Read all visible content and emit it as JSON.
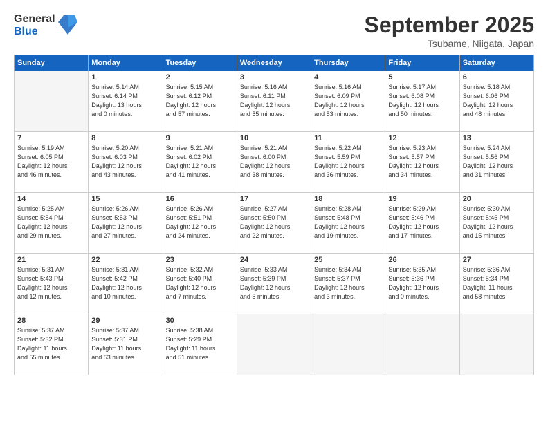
{
  "logo": {
    "general": "General",
    "blue": "Blue"
  },
  "title": "September 2025",
  "location": "Tsubame, Niigata, Japan",
  "days_of_week": [
    "Sunday",
    "Monday",
    "Tuesday",
    "Wednesday",
    "Thursday",
    "Friday",
    "Saturday"
  ],
  "weeks": [
    [
      {
        "day": "",
        "info": ""
      },
      {
        "day": "1",
        "info": "Sunrise: 5:14 AM\nSunset: 6:14 PM\nDaylight: 13 hours\nand 0 minutes."
      },
      {
        "day": "2",
        "info": "Sunrise: 5:15 AM\nSunset: 6:12 PM\nDaylight: 12 hours\nand 57 minutes."
      },
      {
        "day": "3",
        "info": "Sunrise: 5:16 AM\nSunset: 6:11 PM\nDaylight: 12 hours\nand 55 minutes."
      },
      {
        "day": "4",
        "info": "Sunrise: 5:16 AM\nSunset: 6:09 PM\nDaylight: 12 hours\nand 53 minutes."
      },
      {
        "day": "5",
        "info": "Sunrise: 5:17 AM\nSunset: 6:08 PM\nDaylight: 12 hours\nand 50 minutes."
      },
      {
        "day": "6",
        "info": "Sunrise: 5:18 AM\nSunset: 6:06 PM\nDaylight: 12 hours\nand 48 minutes."
      }
    ],
    [
      {
        "day": "7",
        "info": "Sunrise: 5:19 AM\nSunset: 6:05 PM\nDaylight: 12 hours\nand 46 minutes."
      },
      {
        "day": "8",
        "info": "Sunrise: 5:20 AM\nSunset: 6:03 PM\nDaylight: 12 hours\nand 43 minutes."
      },
      {
        "day": "9",
        "info": "Sunrise: 5:21 AM\nSunset: 6:02 PM\nDaylight: 12 hours\nand 41 minutes."
      },
      {
        "day": "10",
        "info": "Sunrise: 5:21 AM\nSunset: 6:00 PM\nDaylight: 12 hours\nand 38 minutes."
      },
      {
        "day": "11",
        "info": "Sunrise: 5:22 AM\nSunset: 5:59 PM\nDaylight: 12 hours\nand 36 minutes."
      },
      {
        "day": "12",
        "info": "Sunrise: 5:23 AM\nSunset: 5:57 PM\nDaylight: 12 hours\nand 34 minutes."
      },
      {
        "day": "13",
        "info": "Sunrise: 5:24 AM\nSunset: 5:56 PM\nDaylight: 12 hours\nand 31 minutes."
      }
    ],
    [
      {
        "day": "14",
        "info": "Sunrise: 5:25 AM\nSunset: 5:54 PM\nDaylight: 12 hours\nand 29 minutes."
      },
      {
        "day": "15",
        "info": "Sunrise: 5:26 AM\nSunset: 5:53 PM\nDaylight: 12 hours\nand 27 minutes."
      },
      {
        "day": "16",
        "info": "Sunrise: 5:26 AM\nSunset: 5:51 PM\nDaylight: 12 hours\nand 24 minutes."
      },
      {
        "day": "17",
        "info": "Sunrise: 5:27 AM\nSunset: 5:50 PM\nDaylight: 12 hours\nand 22 minutes."
      },
      {
        "day": "18",
        "info": "Sunrise: 5:28 AM\nSunset: 5:48 PM\nDaylight: 12 hours\nand 19 minutes."
      },
      {
        "day": "19",
        "info": "Sunrise: 5:29 AM\nSunset: 5:46 PM\nDaylight: 12 hours\nand 17 minutes."
      },
      {
        "day": "20",
        "info": "Sunrise: 5:30 AM\nSunset: 5:45 PM\nDaylight: 12 hours\nand 15 minutes."
      }
    ],
    [
      {
        "day": "21",
        "info": "Sunrise: 5:31 AM\nSunset: 5:43 PM\nDaylight: 12 hours\nand 12 minutes."
      },
      {
        "day": "22",
        "info": "Sunrise: 5:31 AM\nSunset: 5:42 PM\nDaylight: 12 hours\nand 10 minutes."
      },
      {
        "day": "23",
        "info": "Sunrise: 5:32 AM\nSunset: 5:40 PM\nDaylight: 12 hours\nand 7 minutes."
      },
      {
        "day": "24",
        "info": "Sunrise: 5:33 AM\nSunset: 5:39 PM\nDaylight: 12 hours\nand 5 minutes."
      },
      {
        "day": "25",
        "info": "Sunrise: 5:34 AM\nSunset: 5:37 PM\nDaylight: 12 hours\nand 3 minutes."
      },
      {
        "day": "26",
        "info": "Sunrise: 5:35 AM\nSunset: 5:36 PM\nDaylight: 12 hours\nand 0 minutes."
      },
      {
        "day": "27",
        "info": "Sunrise: 5:36 AM\nSunset: 5:34 PM\nDaylight: 11 hours\nand 58 minutes."
      }
    ],
    [
      {
        "day": "28",
        "info": "Sunrise: 5:37 AM\nSunset: 5:32 PM\nDaylight: 11 hours\nand 55 minutes."
      },
      {
        "day": "29",
        "info": "Sunrise: 5:37 AM\nSunset: 5:31 PM\nDaylight: 11 hours\nand 53 minutes."
      },
      {
        "day": "30",
        "info": "Sunrise: 5:38 AM\nSunset: 5:29 PM\nDaylight: 11 hours\nand 51 minutes."
      },
      {
        "day": "",
        "info": ""
      },
      {
        "day": "",
        "info": ""
      },
      {
        "day": "",
        "info": ""
      },
      {
        "day": "",
        "info": ""
      }
    ]
  ]
}
